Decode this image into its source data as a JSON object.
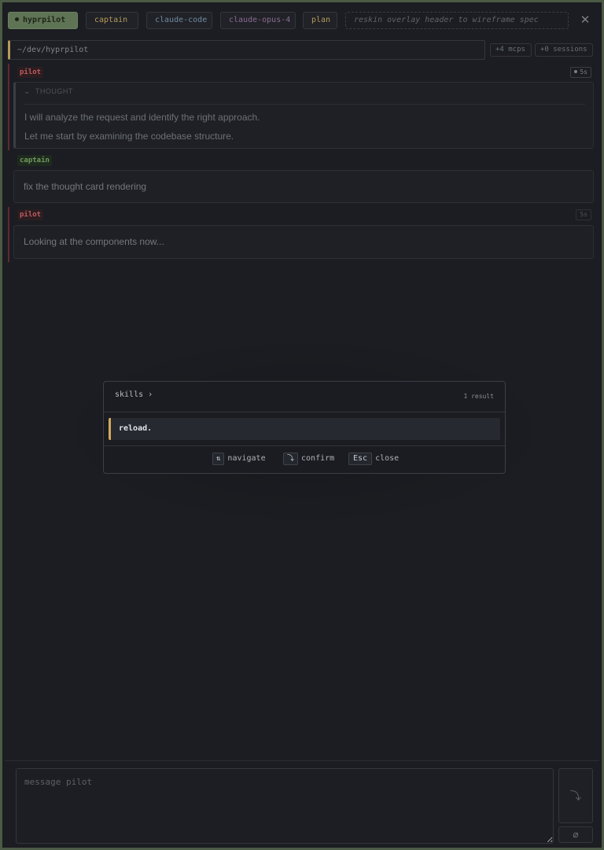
{
  "header": {
    "app_chip": "hyprpilot",
    "captain_chip": "captain",
    "agent_chip": "claude-code",
    "model_chip": "claude-opus-4",
    "mode_chip": "plan",
    "task_title": "reskin overlay header to wireframe spec",
    "close_glyph": "✕"
  },
  "path_bar": {
    "cwd": "~/dev/hyprpilot",
    "mcps": "+4 mcps",
    "sessions": "+0 sessions"
  },
  "transcript": [
    {
      "role": "pilot",
      "time": "5s",
      "thought": {
        "label": "THOUGHT",
        "lines": [
          "I will analyze the request and identify the right approach.",
          "Let me start by examining the codebase structure."
        ]
      }
    },
    {
      "role": "captain",
      "text": "fix the thought card rendering"
    },
    {
      "role": "pilot",
      "time": "5s",
      "text": "Looking at the components now..."
    }
  ],
  "palette": {
    "title": "skills",
    "title_chevron": "›",
    "result_count": "1 result",
    "results": [
      "reload."
    ],
    "hints": [
      {
        "key": "⇅",
        "label": "navigate"
      },
      {
        "key": "⤵",
        "label": "confirm"
      },
      {
        "key": "Esc",
        "label": "close"
      }
    ]
  },
  "composer": {
    "placeholder": "message pilot",
    "send_glyph": "⤵",
    "attach_glyph": "⌀"
  },
  "colors": {
    "frame_border": "#4a5a44",
    "background": "#1b1d22",
    "accent_amber": "#d4a85a",
    "pilot_red": "#c05a60",
    "captain_green": "#6f9a5e"
  }
}
